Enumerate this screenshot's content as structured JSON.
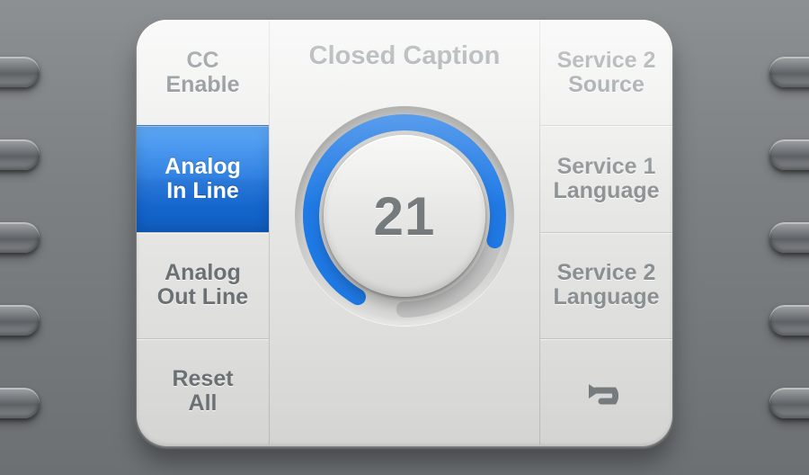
{
  "title": "Closed Caption",
  "dial": {
    "value": "21",
    "progress_deg": 255
  },
  "left_menu": [
    {
      "label": "CC\nEnable",
      "name": "menu-cc-enable",
      "active": false,
      "emph": true
    },
    {
      "label": "Analog\nIn Line",
      "name": "menu-analog-in-line",
      "active": true,
      "emph": false
    },
    {
      "label": "Analog\nOut Line",
      "name": "menu-analog-out-line",
      "active": false,
      "emph": true
    },
    {
      "label": "Reset\nAll",
      "name": "menu-reset-all",
      "active": false,
      "emph": true
    }
  ],
  "right_menu": [
    {
      "label": "Service 2\nSource",
      "name": "menu-service-2-source",
      "active": false
    },
    {
      "label": "Service 1\nLanguage",
      "name": "menu-service-1-language",
      "active": false
    },
    {
      "label": "Service 2\nLanguage",
      "name": "menu-service-2-language",
      "active": false
    },
    {
      "label": "__BACK__",
      "name": "menu-back",
      "active": false
    }
  ],
  "colors": {
    "accent": "#1f7ae6",
    "arc_bg": "#c2c3c2"
  }
}
